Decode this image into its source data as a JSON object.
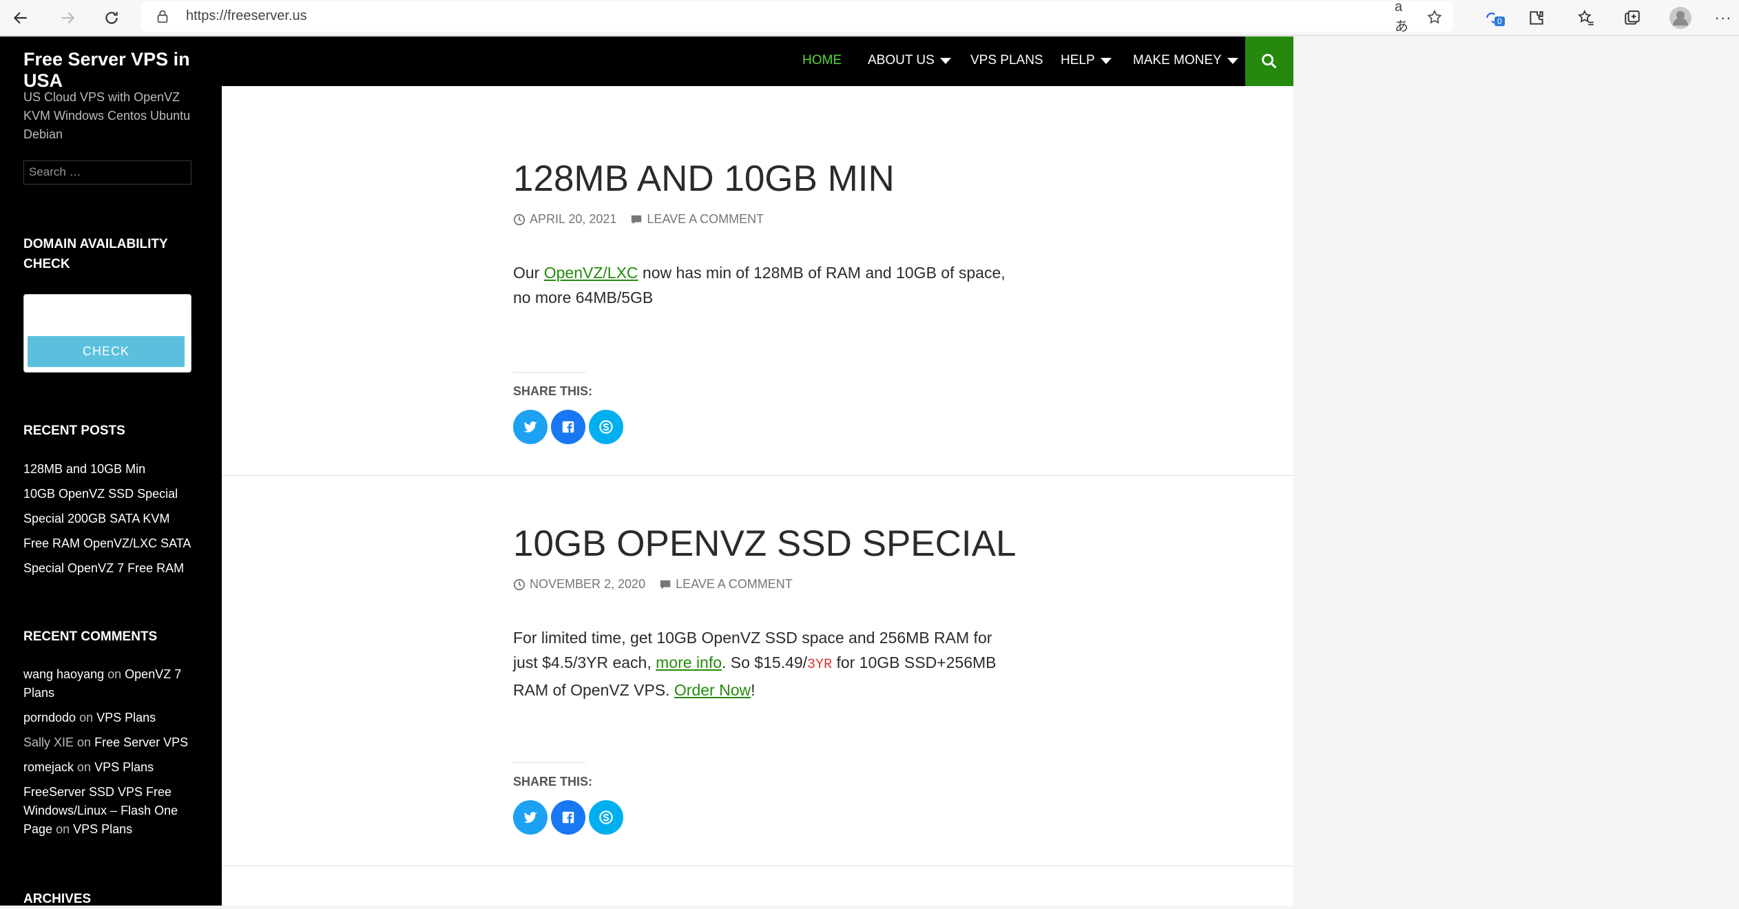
{
  "browser": {
    "url": "https://freeserver.us",
    "collections_badge": "0"
  },
  "site": {
    "title": "Free Server VPS in USA",
    "description": "US Cloud VPS with OpenVZ KVM Windows Centos Ubuntu Debian",
    "search_placeholder": "Search …"
  },
  "nav": {
    "items": [
      {
        "label": "HOME",
        "active": true
      },
      {
        "label": "ABOUT US",
        "dropdown": true
      },
      {
        "label": "VPS PLANS"
      },
      {
        "label": "HELP",
        "dropdown": true
      },
      {
        "label": "MAKE MONEY",
        "dropdown": true
      }
    ]
  },
  "sidebar": {
    "domain_title": "DOMAIN AVAILABILITY CHECK",
    "check_label": "CHECK",
    "recent_posts_title": "RECENT POSTS",
    "recent_posts": [
      "128MB and 10GB Min",
      "10GB OpenVZ SSD Special",
      "Special 200GB SATA KVM",
      "Free RAM OpenVZ/LXC SATA",
      "Special OpenVZ 7 Free RAM"
    ],
    "recent_comments_title": "RECENT COMMENTS",
    "recent_comments": [
      {
        "author": "wang haoyang",
        "on": "on",
        "post": "OpenVZ 7 Plans"
      },
      {
        "author": "porndodo",
        "on": "on",
        "post": "VPS Plans"
      },
      {
        "author": "Sally XIE",
        "on": "on",
        "post": "Free Server VPS"
      },
      {
        "author": "romejack",
        "on": "on",
        "post": "VPS Plans"
      },
      {
        "author": "FreeServer SSD VPS Free Windows/Linux – Flash One Page",
        "on": "on",
        "post": "VPS Plans"
      }
    ],
    "archives_title": "ARCHIVES"
  },
  "posts": [
    {
      "title": "128MB AND 10GB MIN",
      "date": "APRIL 20, 2021",
      "comment_link": "LEAVE A COMMENT",
      "body_pre": "Our ",
      "body_link": "OpenVZ/LXC",
      "body_post": " now has min of 128MB of RAM and 10GB of space, no more 64MB/5GB",
      "share_title": "SHARE THIS:"
    },
    {
      "title": "10GB OPENVZ SSD SPECIAL",
      "date": "NOVEMBER 2, 2020",
      "comment_link": "LEAVE A COMMENT",
      "body_1": "For limited time, get 10GB OpenVZ SSD space and 256MB RAM for just $4.5/3YR each, ",
      "body_link_1": "more info",
      "body_2": ". So $15.49/",
      "body_code": "3YR",
      "body_3": " for 10GB SSD+256MB RAM of OpenVZ VPS. ",
      "body_link_2": "Order Now",
      "body_4": "!",
      "share_title": "SHARE THIS:"
    }
  ],
  "colors": {
    "accent_green": "#24890d",
    "active_nav": "#55d737",
    "twitter": "#1da1f2",
    "facebook": "#1877f2",
    "skype": "#00aff0"
  },
  "icons": [
    "back-icon",
    "forward-icon",
    "refresh-icon",
    "lock-icon",
    "translate-icon",
    "favorite-add-icon",
    "collections-icon",
    "extensions-icon",
    "favorites-icon",
    "tab-actions-icon",
    "profile-icon",
    "more-icon",
    "search-icon",
    "clock-icon",
    "comment-icon",
    "twitter-icon",
    "facebook-icon",
    "skype-icon"
  ]
}
